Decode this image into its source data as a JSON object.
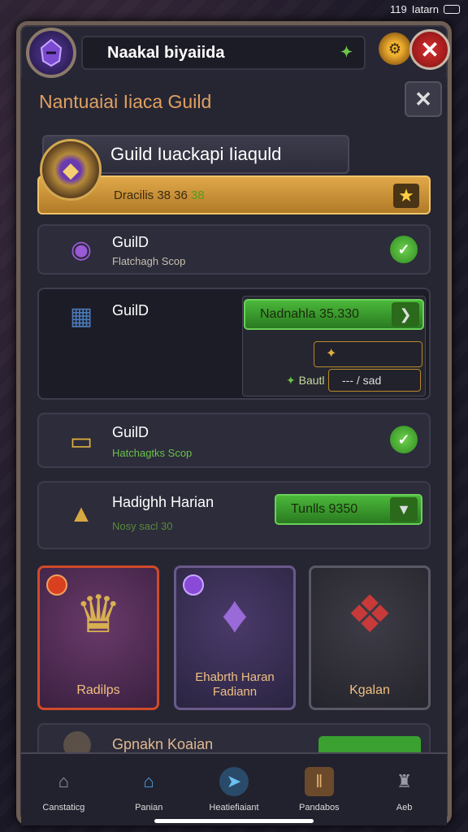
{
  "status": {
    "time": "119",
    "carrier": "Iatarn"
  },
  "header": {
    "player_name": "Naakal biyaiida",
    "avatar_icon": "helmet-avatar",
    "leaf_icon": "leaf-icon",
    "gear_icon": "gear-icon",
    "close_icon": "close-icon"
  },
  "panel": {
    "title": "Nantuaiai Iiaca Guild"
  },
  "guild": {
    "name": "Guild Iuackapi Iiaquld",
    "progress_text": "Dracilis 38 36",
    "progress_suffix": "38"
  },
  "rows": [
    {
      "title": "GuilD",
      "subtitle": "Flatchagh Scop",
      "icon": "purple-orb-icon"
    },
    {
      "title": "GuilD",
      "button_label": "Nadnahla 35.330",
      "sub_label": "Bautl",
      "sub_value": "--- / sad",
      "icon": "book-icon"
    },
    {
      "title": "GuilD",
      "subtitle": "Hatchagtks Scop",
      "icon": "gold-bar-icon"
    },
    {
      "title": "Hadighh Harian",
      "subtitle": "Nosy sacl 30",
      "button_label": "Tunlls 9350",
      "icon": "cart-icon"
    }
  ],
  "rewards": [
    {
      "label": "Radilps",
      "color": "#c84a2a"
    },
    {
      "label": "Ehabrth Haran Fadiann",
      "color": "#8a5ac8"
    },
    {
      "label": "Kgalan",
      "color": "#6a6672"
    }
  ],
  "partial_row": {
    "title": "Gpnakn Koaian"
  },
  "tabs": [
    {
      "label": "Canstaticg",
      "icon": "house-icon"
    },
    {
      "label": "Panian",
      "icon": "shop-icon"
    },
    {
      "label": "Heatiefiaiant",
      "icon": "compass-icon"
    },
    {
      "label": "Pandabos",
      "icon": "pillar-icon"
    },
    {
      "label": "Aeb",
      "icon": "castle-icon"
    }
  ]
}
